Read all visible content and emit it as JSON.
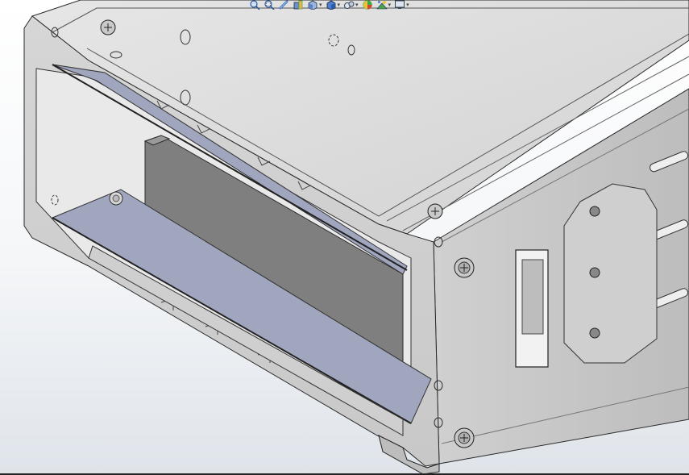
{
  "app": {
    "viewport_background_top": "#ffffff",
    "viewport_background_bottom": "#dfe4ea",
    "part_color": "#dcdcdc",
    "part_shade": "#b4b4b4",
    "pcb_color": "#a1a6bf",
    "edge_color": "#2a2a2a"
  },
  "heads_up_toolbar": {
    "buttons": [
      {
        "icon": "zoom-to-fit-icon",
        "has_dropdown": false
      },
      {
        "icon": "zoom-to-area-icon",
        "has_dropdown": false
      },
      {
        "icon": "previous-view-icon",
        "has_dropdown": false
      },
      {
        "icon": "section-view-icon",
        "has_dropdown": false
      },
      {
        "icon": "view-orientation-icon",
        "has_dropdown": true
      },
      {
        "icon": "display-style-icon",
        "has_dropdown": true
      },
      {
        "icon": "hide-show-items-icon",
        "has_dropdown": true
      },
      {
        "icon": "edit-appearance-icon",
        "has_dropdown": false
      },
      {
        "icon": "apply-scene-icon",
        "has_dropdown": true
      },
      {
        "icon": "view-settings-icon",
        "has_dropdown": true
      }
    ]
  }
}
